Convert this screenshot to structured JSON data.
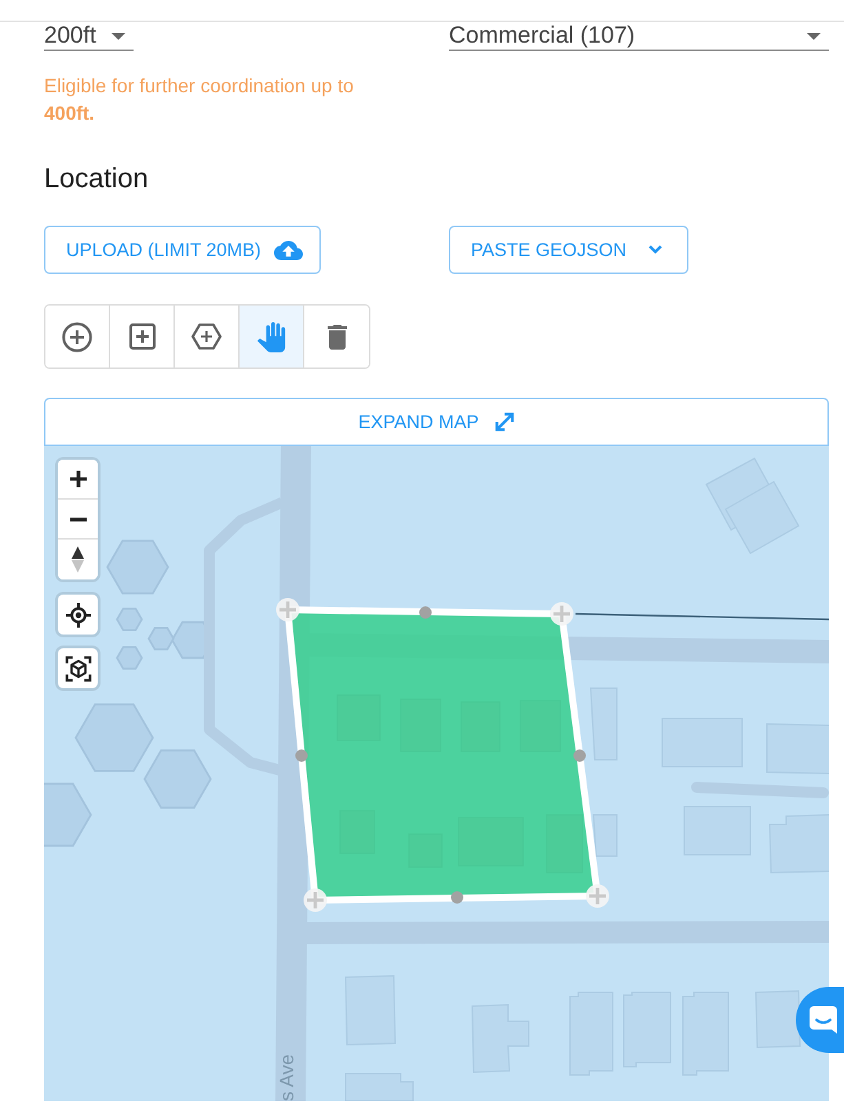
{
  "dropdowns": [
    {
      "value": "200ft"
    },
    {
      "value": "Commercial (107)"
    }
  ],
  "note": "Eligible for further coordination up to **400ft.**",
  "section_title": "Location",
  "buttons": [
    {
      "label": "UPLOAD (LIMIT 20MB)",
      "kind": "upload"
    },
    {
      "label": "PASTE GEOJSON",
      "kind": "menu"
    }
  ],
  "tools": [
    {
      "kind": "point",
      "selected": false
    },
    {
      "kind": "rectangle",
      "selected": false
    },
    {
      "kind": "polygon",
      "selected": false
    },
    {
      "kind": "pan",
      "selected": true
    },
    {
      "kind": "delete",
      "selected": false
    }
  ],
  "expand_button": {
    "label": "EXPAND MAP"
  },
  "map": {
    "street_label": "s Ave"
  }
}
